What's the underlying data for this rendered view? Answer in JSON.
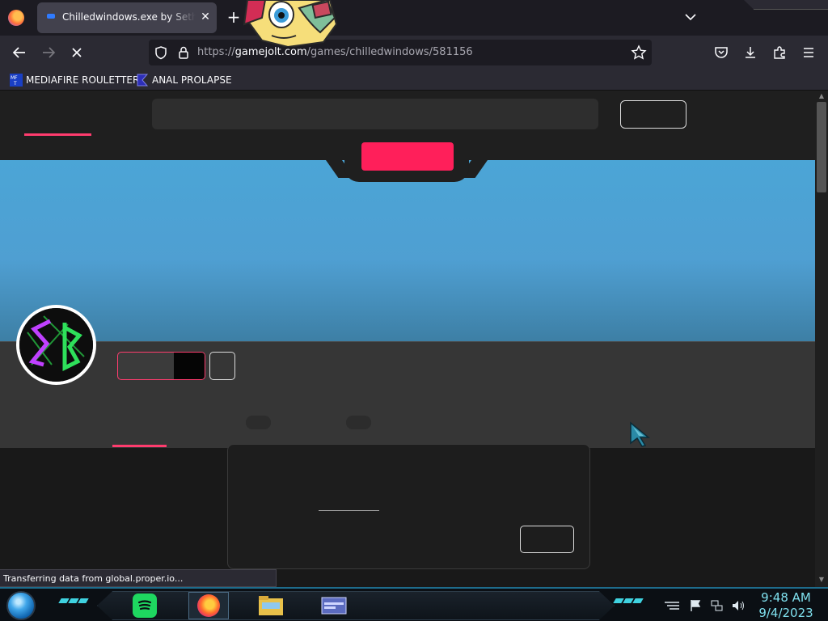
{
  "browser": {
    "tab_title": "Chilledwindows.exe by Sethnoo",
    "tab_close": "✕",
    "new_tab": "+",
    "url_prefix": "https://",
    "url_host": "gamejolt.com",
    "url_path": "/games/chilledwindows/581156",
    "bookmarks": [
      {
        "label": "MEDIAFIRE ROULETTER",
        "icon": "mediafire-icon"
      },
      {
        "label": "ANAL PROLAPSE",
        "icon": "sigma-icon"
      }
    ],
    "status_text": "Transferring data from global.proper.io..."
  },
  "taskbar": {
    "time": "9:48 AM",
    "date": "9/4/2023",
    "apps": [
      "spotify-icon",
      "firefox-icon",
      "file-explorer-icon",
      "window-icon"
    ]
  },
  "colors": {
    "accent_pink": "#ff1f5a",
    "banner_blue": "#4ba5d6",
    "taskbar_cyan": "#3fd2e0"
  }
}
